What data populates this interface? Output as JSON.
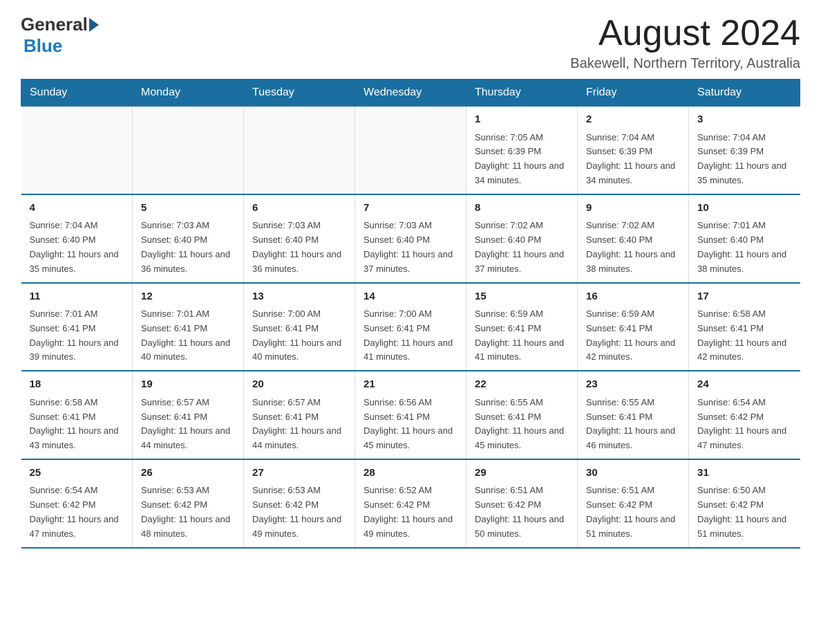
{
  "logo": {
    "general": "General",
    "blue": "Blue"
  },
  "title": "August 2024",
  "location": "Bakewell, Northern Territory, Australia",
  "days_of_week": [
    "Sunday",
    "Monday",
    "Tuesday",
    "Wednesday",
    "Thursday",
    "Friday",
    "Saturday"
  ],
  "weeks": [
    [
      {
        "day": "",
        "info": ""
      },
      {
        "day": "",
        "info": ""
      },
      {
        "day": "",
        "info": ""
      },
      {
        "day": "",
        "info": ""
      },
      {
        "day": "1",
        "info": "Sunrise: 7:05 AM\nSunset: 6:39 PM\nDaylight: 11 hours and 34 minutes."
      },
      {
        "day": "2",
        "info": "Sunrise: 7:04 AM\nSunset: 6:39 PM\nDaylight: 11 hours and 34 minutes."
      },
      {
        "day": "3",
        "info": "Sunrise: 7:04 AM\nSunset: 6:39 PM\nDaylight: 11 hours and 35 minutes."
      }
    ],
    [
      {
        "day": "4",
        "info": "Sunrise: 7:04 AM\nSunset: 6:40 PM\nDaylight: 11 hours and 35 minutes."
      },
      {
        "day": "5",
        "info": "Sunrise: 7:03 AM\nSunset: 6:40 PM\nDaylight: 11 hours and 36 minutes."
      },
      {
        "day": "6",
        "info": "Sunrise: 7:03 AM\nSunset: 6:40 PM\nDaylight: 11 hours and 36 minutes."
      },
      {
        "day": "7",
        "info": "Sunrise: 7:03 AM\nSunset: 6:40 PM\nDaylight: 11 hours and 37 minutes."
      },
      {
        "day": "8",
        "info": "Sunrise: 7:02 AM\nSunset: 6:40 PM\nDaylight: 11 hours and 37 minutes."
      },
      {
        "day": "9",
        "info": "Sunrise: 7:02 AM\nSunset: 6:40 PM\nDaylight: 11 hours and 38 minutes."
      },
      {
        "day": "10",
        "info": "Sunrise: 7:01 AM\nSunset: 6:40 PM\nDaylight: 11 hours and 38 minutes."
      }
    ],
    [
      {
        "day": "11",
        "info": "Sunrise: 7:01 AM\nSunset: 6:41 PM\nDaylight: 11 hours and 39 minutes."
      },
      {
        "day": "12",
        "info": "Sunrise: 7:01 AM\nSunset: 6:41 PM\nDaylight: 11 hours and 40 minutes."
      },
      {
        "day": "13",
        "info": "Sunrise: 7:00 AM\nSunset: 6:41 PM\nDaylight: 11 hours and 40 minutes."
      },
      {
        "day": "14",
        "info": "Sunrise: 7:00 AM\nSunset: 6:41 PM\nDaylight: 11 hours and 41 minutes."
      },
      {
        "day": "15",
        "info": "Sunrise: 6:59 AM\nSunset: 6:41 PM\nDaylight: 11 hours and 41 minutes."
      },
      {
        "day": "16",
        "info": "Sunrise: 6:59 AM\nSunset: 6:41 PM\nDaylight: 11 hours and 42 minutes."
      },
      {
        "day": "17",
        "info": "Sunrise: 6:58 AM\nSunset: 6:41 PM\nDaylight: 11 hours and 42 minutes."
      }
    ],
    [
      {
        "day": "18",
        "info": "Sunrise: 6:58 AM\nSunset: 6:41 PM\nDaylight: 11 hours and 43 minutes."
      },
      {
        "day": "19",
        "info": "Sunrise: 6:57 AM\nSunset: 6:41 PM\nDaylight: 11 hours and 44 minutes."
      },
      {
        "day": "20",
        "info": "Sunrise: 6:57 AM\nSunset: 6:41 PM\nDaylight: 11 hours and 44 minutes."
      },
      {
        "day": "21",
        "info": "Sunrise: 6:56 AM\nSunset: 6:41 PM\nDaylight: 11 hours and 45 minutes."
      },
      {
        "day": "22",
        "info": "Sunrise: 6:55 AM\nSunset: 6:41 PM\nDaylight: 11 hours and 45 minutes."
      },
      {
        "day": "23",
        "info": "Sunrise: 6:55 AM\nSunset: 6:41 PM\nDaylight: 11 hours and 46 minutes."
      },
      {
        "day": "24",
        "info": "Sunrise: 6:54 AM\nSunset: 6:42 PM\nDaylight: 11 hours and 47 minutes."
      }
    ],
    [
      {
        "day": "25",
        "info": "Sunrise: 6:54 AM\nSunset: 6:42 PM\nDaylight: 11 hours and 47 minutes."
      },
      {
        "day": "26",
        "info": "Sunrise: 6:53 AM\nSunset: 6:42 PM\nDaylight: 11 hours and 48 minutes."
      },
      {
        "day": "27",
        "info": "Sunrise: 6:53 AM\nSunset: 6:42 PM\nDaylight: 11 hours and 49 minutes."
      },
      {
        "day": "28",
        "info": "Sunrise: 6:52 AM\nSunset: 6:42 PM\nDaylight: 11 hours and 49 minutes."
      },
      {
        "day": "29",
        "info": "Sunrise: 6:51 AM\nSunset: 6:42 PM\nDaylight: 11 hours and 50 minutes."
      },
      {
        "day": "30",
        "info": "Sunrise: 6:51 AM\nSunset: 6:42 PM\nDaylight: 11 hours and 51 minutes."
      },
      {
        "day": "31",
        "info": "Sunrise: 6:50 AM\nSunset: 6:42 PM\nDaylight: 11 hours and 51 minutes."
      }
    ]
  ]
}
